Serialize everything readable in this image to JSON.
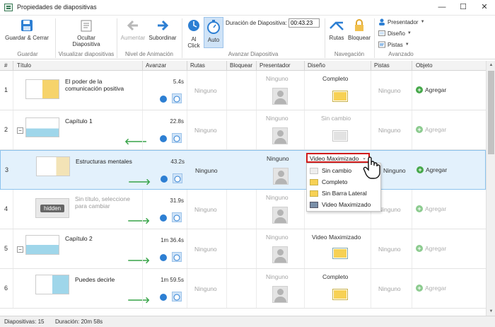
{
  "window": {
    "title": "Propiedades de diapositivas",
    "min": "—",
    "max": "☐",
    "close": "✕"
  },
  "ribbon": {
    "save_close": "Guardar & Cerrar",
    "hide_slide": "Ocultar Diapositiva",
    "increase": "Aumentar",
    "demote": "Subordinar",
    "on_click": "Al Click",
    "auto": "Auto",
    "duration_label": "Duración de Diapositiva:",
    "duration_value": "00:43.23",
    "routes": "Rutas",
    "lock": "Bloquear",
    "presenter": "Presentador",
    "design": "Diseño",
    "tracks": "Pistas",
    "groups": {
      "save": "Guardar",
      "slide_view": "Visualizar diapositivas",
      "anim_level": "Nivel de Animación",
      "adv_slide": "Avanzar Diapositiva",
      "navigation": "Navegación",
      "advanced": "Avanzado"
    }
  },
  "columns": [
    "#",
    "Título",
    "Avanzar",
    "Rutas",
    "Bloquear",
    "Presentador",
    "Diseño",
    "Pistas",
    "Objeto"
  ],
  "rows": [
    {
      "num": "1",
      "title": "El poder de la comunicación positiva",
      "time": "5.4s",
      "routes": "Ninguno",
      "presenter": "Ninguno",
      "design": "Completo",
      "tracks": "Ninguno",
      "object": "Agregar"
    },
    {
      "num": "2",
      "title": "Capítulo 1",
      "time": "22.8s",
      "routes": "Ninguno",
      "presenter": "Ninguno",
      "design": "Sin cambio",
      "tracks": "Ninguno",
      "object": "Agregar"
    },
    {
      "num": "3",
      "title": "Estructuras mentales",
      "time": "43.2s",
      "routes": "Ninguno",
      "presenter": "Ninguno",
      "design": "Video Maximizado",
      "tracks": "Ninguno",
      "object": "Agregar"
    },
    {
      "num": "4",
      "title": "Sin título, seleccione para cambiar",
      "time": "31.9s",
      "routes": "Ninguno",
      "presenter": "Ninguno",
      "design": "",
      "tracks": "Ninguno",
      "object": "Agregar",
      "hidden_label": "hidden"
    },
    {
      "num": "5",
      "title": "Capítulo 2",
      "time": "1m 36.4s",
      "routes": "Ninguno",
      "presenter": "Ninguno",
      "design": "Video Maximizado",
      "tracks": "Ninguno",
      "object": "Agregar"
    },
    {
      "num": "6",
      "title": "Puedes decirle",
      "time": "1m 59.5s",
      "routes": "Ninguno",
      "presenter": "Ninguno",
      "design": "Completo",
      "tracks": "Ninguno",
      "object": "Agregar"
    }
  ],
  "dropdown": {
    "selected": "Video Maximizado",
    "options": [
      "Sin cambio",
      "Completo",
      "Sin Barra Lateral",
      "Video Maximizado"
    ]
  },
  "status": {
    "slides": "Diapositivas: 15",
    "duration": "Duración: 20m 58s"
  },
  "colors": {
    "accent_blue": "#2d7fd3",
    "add_green": "#46a84a",
    "highlight_red": "#d11c1c",
    "design_yellow": "#f7d154"
  }
}
